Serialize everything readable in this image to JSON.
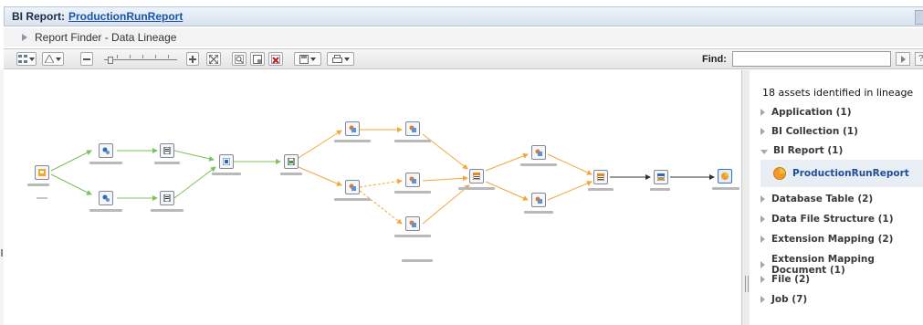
{
  "header": {
    "prefix": "BI Report:",
    "report_name": "ProductionRunReport"
  },
  "breadcrumb": {
    "label": "Report Finder - Data Lineage"
  },
  "toolbar": {
    "find_label": "Find:",
    "find_value": "",
    "help_label": "?"
  },
  "lineage_panel": {
    "summary": "18 assets identified in lineage",
    "categories": [
      {
        "label": "Application (1)",
        "expanded": false
      },
      {
        "label": "BI Collection (1)",
        "expanded": false
      },
      {
        "label": "BI Report (1)",
        "expanded": true
      },
      {
        "label": "Database Table (2)",
        "expanded": false
      },
      {
        "label": "Data File Structure (1)",
        "expanded": false
      },
      {
        "label": "Extension Mapping (2)",
        "expanded": false
      },
      {
        "label": "Extension Mapping Document (1)",
        "expanded": false
      },
      {
        "label": "File (2)",
        "expanded": false
      },
      {
        "label": "Job (7)",
        "expanded": false
      }
    ],
    "selected_item": "ProductionRunReport"
  },
  "graph": {
    "edge_colors": {
      "green": "#7cc25a",
      "orange": "#f0a83a",
      "black": "#333333"
    },
    "nodes": [
      {
        "id": "n1",
        "icon": "application-icon"
      },
      {
        "id": "n2",
        "icon": "database-table-icon"
      },
      {
        "id": "n3",
        "icon": "database-table-icon"
      },
      {
        "id": "n4",
        "icon": "file-icon"
      },
      {
        "id": "n5",
        "icon": "file-icon"
      },
      {
        "id": "n6",
        "icon": "data-file-structure-icon"
      },
      {
        "id": "n7",
        "icon": "extension-mapping-icon"
      },
      {
        "id": "n8",
        "icon": "job-icon"
      },
      {
        "id": "n9",
        "icon": "job-icon"
      },
      {
        "id": "n10",
        "icon": "job-icon"
      },
      {
        "id": "n11",
        "icon": "job-icon"
      },
      {
        "id": "n12",
        "icon": "job-icon"
      },
      {
        "id": "n13",
        "icon": "extension-mapping-document-icon"
      },
      {
        "id": "n14",
        "icon": "job-icon"
      },
      {
        "id": "n15",
        "icon": "job-icon"
      },
      {
        "id": "n16",
        "icon": "extension-mapping-document-icon"
      },
      {
        "id": "n17",
        "icon": "bi-collection-icon"
      },
      {
        "id": "n18",
        "icon": "bi-report-icon"
      }
    ]
  }
}
